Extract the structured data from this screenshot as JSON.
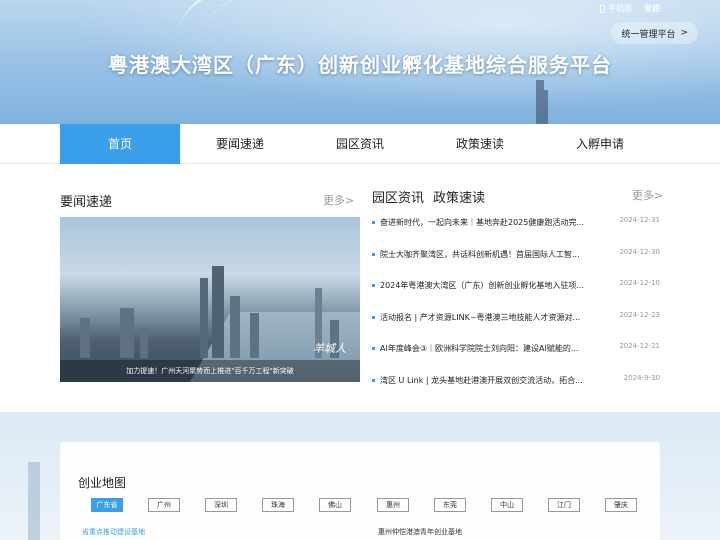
{
  "header": {
    "title": "粤港澳大湾区（广东）创新创业孵化基地综合服务平台",
    "links": {
      "mobile": "手机版",
      "traditional": "繁體"
    },
    "mgmt_button": "统一管理平台",
    "mgmt_arrow": ">"
  },
  "nav": {
    "items": [
      {
        "label": "首页"
      },
      {
        "label": "要闻速递"
      },
      {
        "label": "园区资讯"
      },
      {
        "label": "政策速读"
      },
      {
        "label": "入孵申请"
      }
    ]
  },
  "news_left": {
    "title": "要闻速递",
    "more": "更多>",
    "caption": "加力提速！广州天河聚势而上推进\"百千万工程\"新突破",
    "signature": "羊城人"
  },
  "news_right": {
    "tabs": [
      "园区资讯",
      "政策速读"
    ],
    "more": "更多>",
    "items": [
      {
        "title": "奋进新时代，一起向未来｜基地奔赴2025健康跑活动完...",
        "date": "2024-12-31"
      },
      {
        "title": "院士大咖齐聚湾区，共话科创新机遇！首届国际人工智...",
        "date": "2024-12-30"
      },
      {
        "title": "2024年粤港澳大湾区（广东）创新创业孵化基地入驻项...",
        "date": "2024-12-10"
      },
      {
        "title": "活动报名 | 产才资源LINK~粤港澳三地技能人才资源对...",
        "date": "2024-12-23"
      },
      {
        "title": "AI年度峰会③｜欧洲科学院院士刘向阳：建设AI赋能的...",
        "date": "2024-12-21"
      },
      {
        "title": "湾区 U Link | 龙头基地赴港澳开展双创交流活动，拓合...",
        "date": "2024-9-30"
      }
    ]
  },
  "map_section": {
    "title": "创业地图",
    "regions": [
      "广东省",
      "广州",
      "深圳",
      "珠海",
      "佛山",
      "惠州",
      "东莞",
      "中山",
      "江门",
      "肇庆"
    ],
    "sub_left": "省重点推动建设基地",
    "sub_right": "惠州仲恺港澳青年创业基地"
  },
  "colors": {
    "accent": "#3a9fe8",
    "muted": "#999999"
  },
  "icons": [
    "phone-icon",
    "chevron-right-icon",
    "bullet-icon"
  ]
}
